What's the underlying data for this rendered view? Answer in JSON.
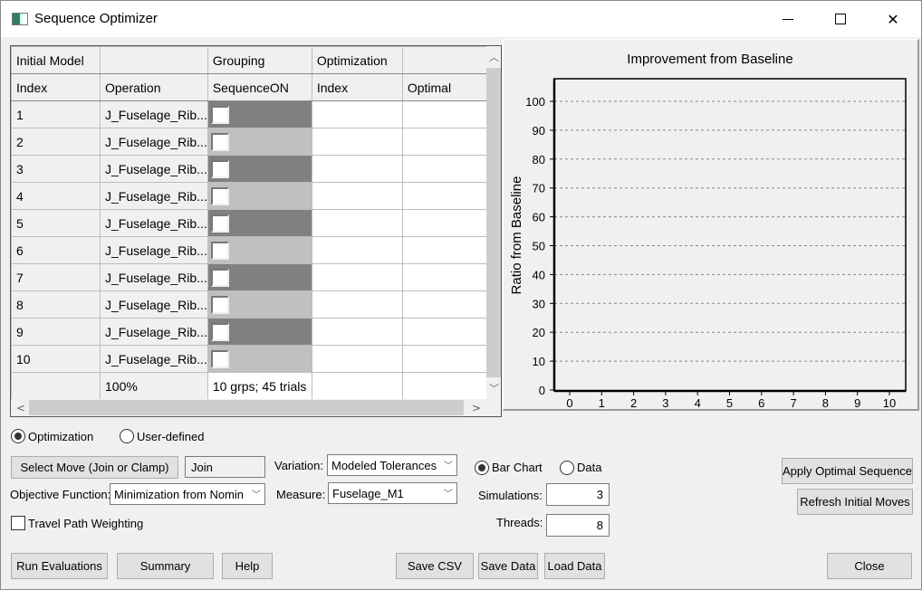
{
  "window": {
    "title": "Sequence Optimizer",
    "minimize": "minimize",
    "maximize": "maximize",
    "close": "close"
  },
  "grid": {
    "header_row1": [
      "Initial Model",
      "",
      "Grouping",
      "Optimization",
      ""
    ],
    "header_row2": [
      "Index",
      "Operation",
      "SequenceON",
      "Index",
      "Optimal"
    ],
    "rows": [
      {
        "index": "1",
        "operation": "J_Fuselage_Rib...",
        "checked": false,
        "group_shade": "dark",
        "opt_index": "",
        "optimal": ""
      },
      {
        "index": "2",
        "operation": "J_Fuselage_Rib...",
        "checked": false,
        "group_shade": "light",
        "opt_index": "",
        "optimal": ""
      },
      {
        "index": "3",
        "operation": "J_Fuselage_Rib...",
        "checked": false,
        "group_shade": "dark",
        "opt_index": "",
        "optimal": ""
      },
      {
        "index": "4",
        "operation": "J_Fuselage_Rib...",
        "checked": false,
        "group_shade": "light",
        "opt_index": "",
        "optimal": ""
      },
      {
        "index": "5",
        "operation": "J_Fuselage_Rib...",
        "checked": false,
        "group_shade": "dark",
        "opt_index": "",
        "optimal": ""
      },
      {
        "index": "6",
        "operation": "J_Fuselage_Rib...",
        "checked": false,
        "group_shade": "light",
        "opt_index": "",
        "optimal": ""
      },
      {
        "index": "7",
        "operation": "J_Fuselage_Rib...",
        "checked": false,
        "group_shade": "dark",
        "opt_index": "",
        "optimal": ""
      },
      {
        "index": "8",
        "operation": "J_Fuselage_Rib...",
        "checked": false,
        "group_shade": "light",
        "opt_index": "",
        "optimal": ""
      },
      {
        "index": "9",
        "operation": "J_Fuselage_Rib...",
        "checked": false,
        "group_shade": "dark",
        "opt_index": "",
        "optimal": ""
      },
      {
        "index": "10",
        "operation": "J_Fuselage_Rib...",
        "checked": false,
        "group_shade": "light",
        "opt_index": "",
        "optimal": ""
      }
    ],
    "summary_row": [
      "",
      "100%",
      "10 grps; 45 trials",
      "",
      ""
    ],
    "colors": {
      "group_dark": "#808080",
      "group_light": "#c0c0c0"
    }
  },
  "chart_data": {
    "type": "bar",
    "title": "Improvement from Baseline",
    "xlabel": "",
    "ylabel": "Ratio from Baseline",
    "x_ticks": [
      "0",
      "1",
      "2",
      "3",
      "4",
      "5",
      "6",
      "7",
      "8",
      "9",
      "10"
    ],
    "y_ticks": [
      "0",
      "10",
      "20",
      "30",
      "40",
      "50",
      "60",
      "70",
      "80",
      "90",
      "100"
    ],
    "xlim": [
      0,
      10
    ],
    "ylim": [
      0,
      100
    ],
    "grid": "horizontal-dashed",
    "series": [],
    "categories": [],
    "values": []
  },
  "controls": {
    "mode_radio": [
      {
        "label": "Optimization",
        "selected": true
      },
      {
        "label": "User-defined",
        "selected": false
      }
    ],
    "select_move_button": "Select Move (Join or Clamp)",
    "move_value": "Join",
    "variation_label": "Variation:",
    "variation_value": "Modeled Tolerances",
    "measure_label": "Measure:",
    "measure_value": "Fuselage_M1",
    "objective_label": "Objective Function:",
    "objective_value": "Minimization from Nomin",
    "travel_path_label": "Travel Path Weighting",
    "travel_path_checked": false,
    "view_radio": [
      {
        "label": "Bar Chart",
        "selected": true
      },
      {
        "label": "Data",
        "selected": false
      }
    ],
    "simulations_label": "Simulations:",
    "simulations_value": "3",
    "threads_label": "Threads:",
    "threads_value": "8",
    "apply_optimal_button": "Apply Optimal Sequence",
    "refresh_button": "Refresh Initial Moves"
  },
  "footer": {
    "run_button": "Run Evaluations",
    "summary_button": "Summary",
    "help_button": "Help",
    "save_csv_button": "Save CSV",
    "save_data_button": "Save Data",
    "load_data_button": "Load Data",
    "close_button": "Close"
  }
}
